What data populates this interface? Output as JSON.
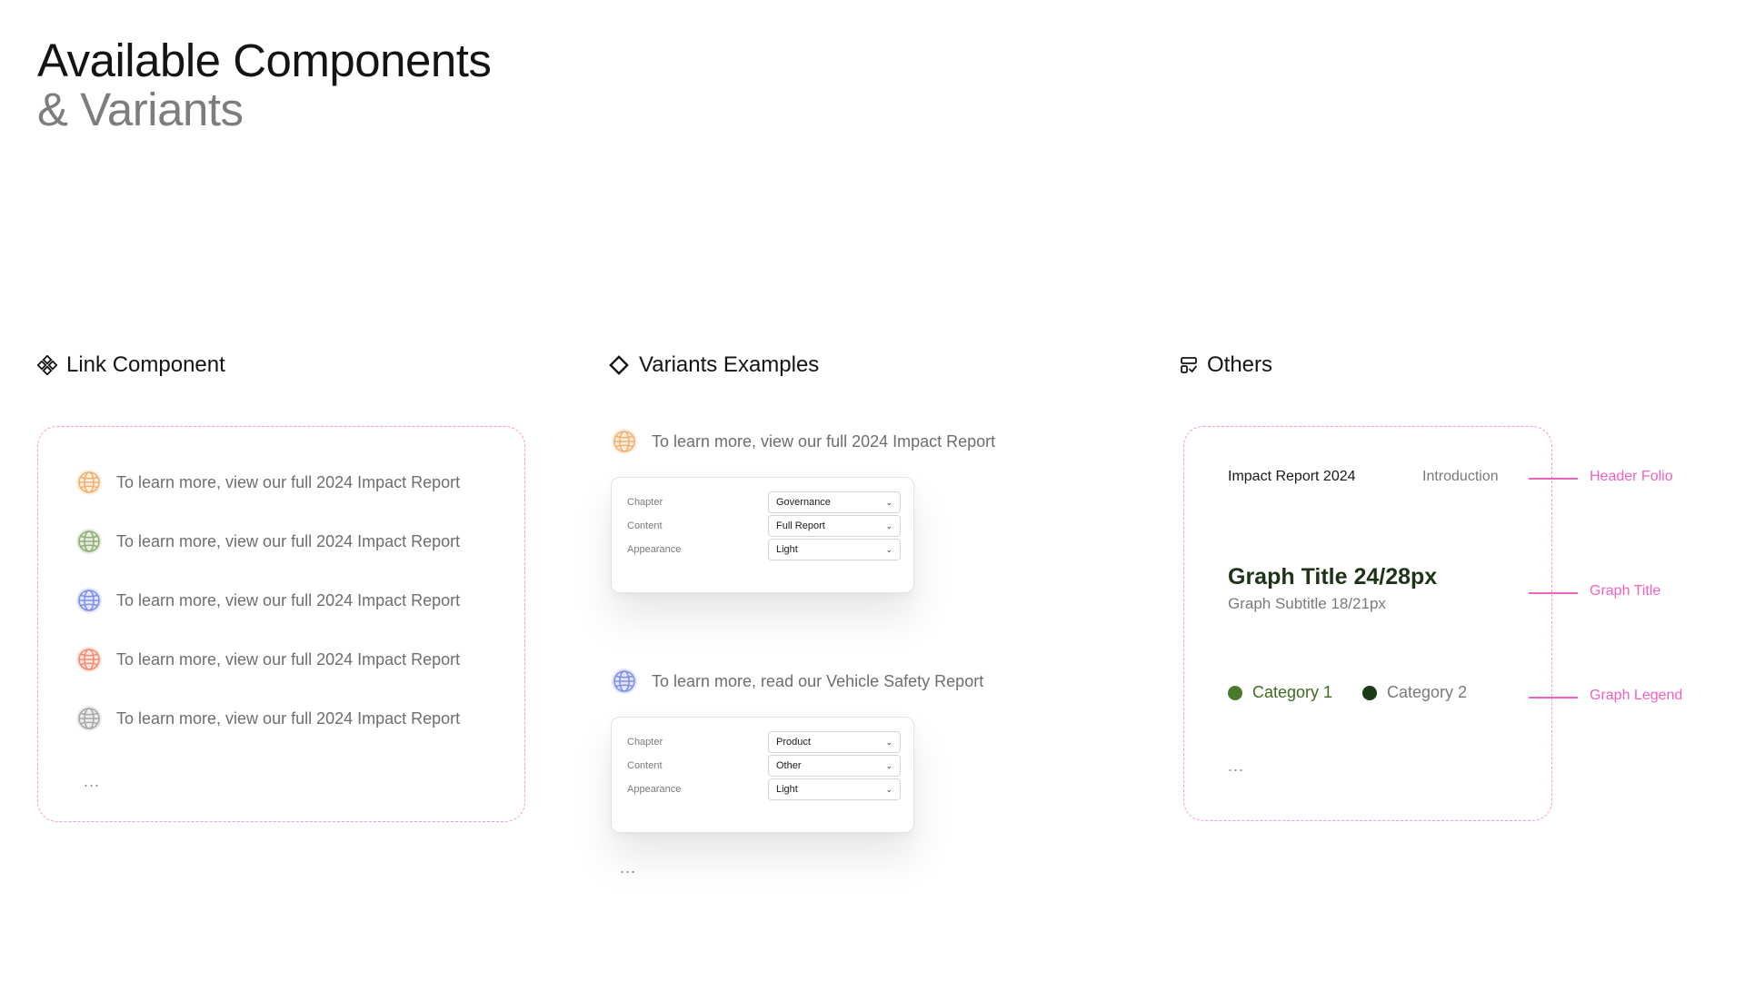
{
  "title": {
    "line1": "Available Components",
    "line2": "& Variants"
  },
  "sections": {
    "link_component": "Link Component",
    "variants_examples": "Variants Examples",
    "others": "Others"
  },
  "link_component": {
    "items": [
      {
        "label": "To learn more, view our full 2024 Impact Report",
        "color": "#f0b070"
      },
      {
        "label": "To learn more, view our full 2024 Impact Report",
        "color": "#8fae72"
      },
      {
        "label": "To learn more, view our full 2024 Impact Report",
        "color": "#7f8fe8"
      },
      {
        "label": "To learn more, view our full 2024 Impact Report",
        "color": "#f38c72"
      },
      {
        "label": "To learn more, view our full 2024 Impact Report",
        "color": "#a8a8a8"
      }
    ],
    "more": "..."
  },
  "variants": {
    "example1": {
      "link": "To learn more, view our full 2024 Impact Report",
      "color": "#f0b070",
      "fields": [
        {
          "label": "Chapter",
          "value": "Governance"
        },
        {
          "label": "Content",
          "value": "Full Report"
        },
        {
          "label": "Appearance",
          "value": "Light"
        }
      ]
    },
    "example2": {
      "link": "To learn more, read our Vehicle Safety Report",
      "color": "#7f8fe8",
      "fields": [
        {
          "label": "Chapter",
          "value": "Product"
        },
        {
          "label": "Content",
          "value": "Other"
        },
        {
          "label": "Appearance",
          "value": "Light"
        }
      ]
    },
    "more": "..."
  },
  "others": {
    "folio_left": "Impact Report 2024",
    "folio_right": "Introduction",
    "graph_title": "Graph Title 24/28px",
    "graph_subtitle": "Graph Subtitle 18/21px",
    "legend": [
      {
        "label": "Category 1",
        "color": "#4a7a2c",
        "text_color": "#3f6a22"
      },
      {
        "label": "Category 2",
        "color": "#1c3a16",
        "text_color": "#7a7a7a"
      }
    ],
    "more": "...",
    "annotations": {
      "header_folio": "Header Folio",
      "graph_title": "Graph Title",
      "graph_legend": "Graph Legend"
    },
    "annotation_color": "#f062c0"
  }
}
